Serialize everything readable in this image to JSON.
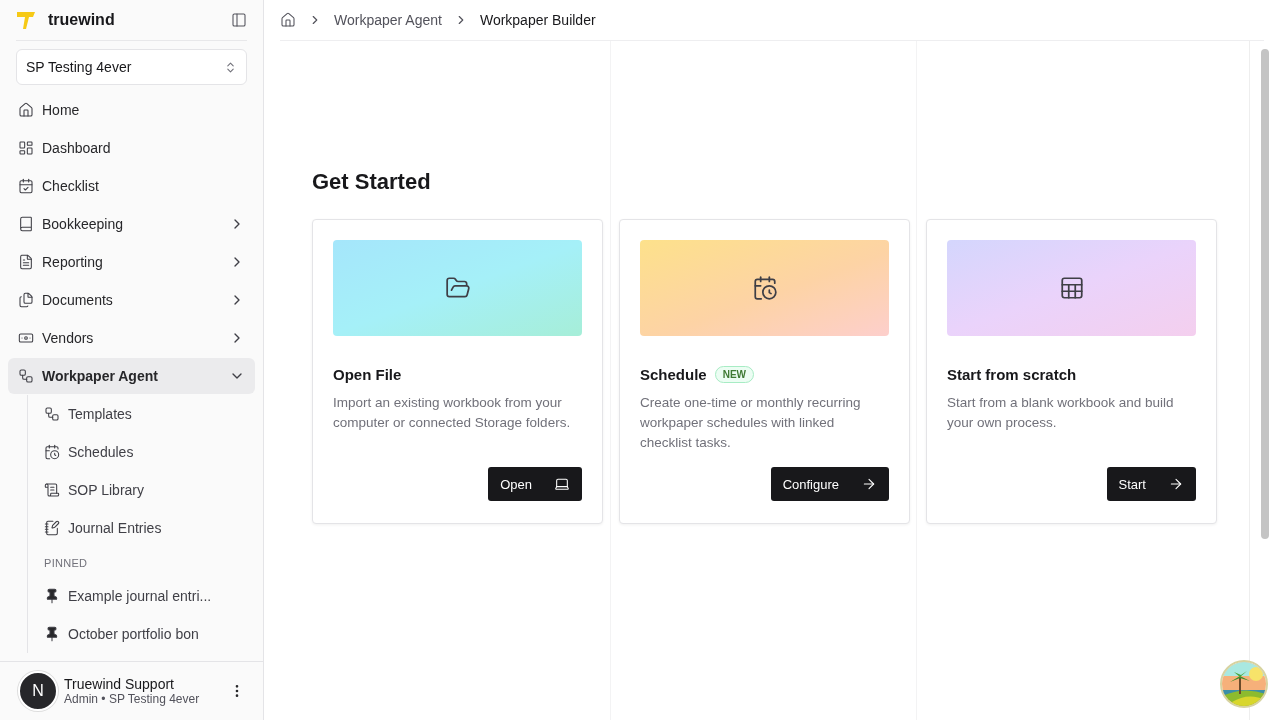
{
  "brand": {
    "name": "truewind"
  },
  "workspace": {
    "value": "SP Testing 4ever"
  },
  "nav": [
    {
      "label": "Home",
      "selected": false
    },
    {
      "label": "Dashboard",
      "selected": false
    },
    {
      "label": "Checklist",
      "selected": false
    },
    {
      "label": "Bookkeeping",
      "expanded": false,
      "selected": false
    },
    {
      "label": "Reporting",
      "expanded": false,
      "selected": false
    },
    {
      "label": "Documents",
      "expanded": false,
      "selected": false
    },
    {
      "label": "Vendors",
      "expanded": false,
      "selected": false
    },
    {
      "label": "Workpaper Agent",
      "expanded": true,
      "selected": true,
      "children": [
        {
          "label": "Templates"
        },
        {
          "label": "Schedules"
        },
        {
          "label": "SOP Library"
        },
        {
          "label": "Journal Entries"
        }
      ]
    }
  ],
  "pinned": {
    "heading": "PINNED",
    "items": [
      {
        "label": "Example journal entri..."
      },
      {
        "label": "October portfolio bon"
      }
    ]
  },
  "user": {
    "initial": "N",
    "name": "Truewind Support",
    "role": "Admin • SP Testing 4ever"
  },
  "breadcrumb": [
    {
      "label": "Workpaper Agent",
      "selected": false
    },
    {
      "label": "Workpaper Builder",
      "selected": true
    }
  ],
  "page": {
    "title": "Get Started"
  },
  "cards": [
    {
      "title": "Open File",
      "text": "Import an existing workbook from your computer or connected Storage folders.",
      "button": "Open"
    },
    {
      "title": "Schedule",
      "badge": "NEW",
      "text": "Create one-time or monthly recurring workpaper schedules with linked checklist tasks.",
      "button": "Configure"
    },
    {
      "title": "Start from scratch",
      "text": "Start from a blank workbook and build your own process.",
      "button": "Start"
    }
  ]
}
